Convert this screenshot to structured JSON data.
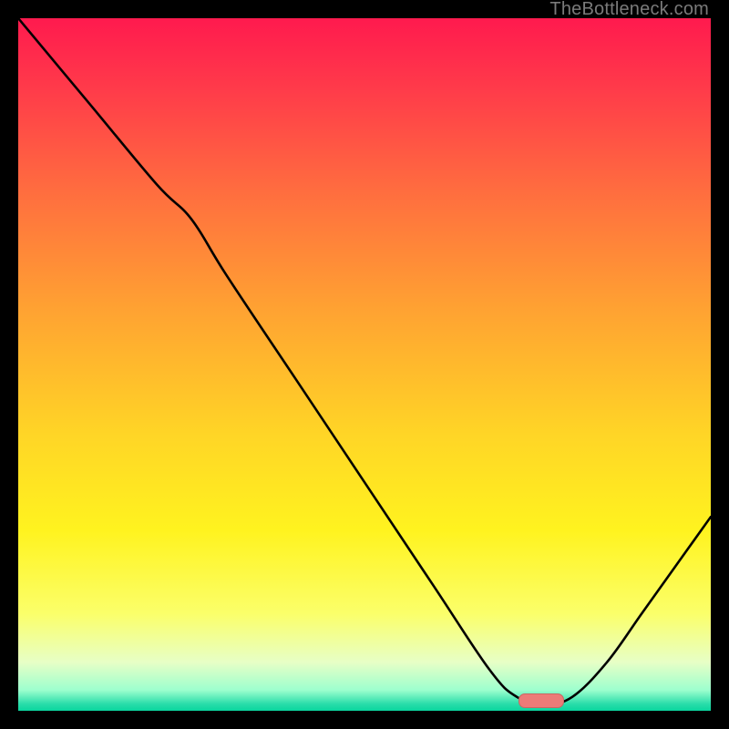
{
  "watermark": "TheBottleneck.com",
  "marker": {
    "u": 0.755,
    "v": 0.986
  },
  "chart_data": {
    "type": "line",
    "title": "",
    "xlabel": "",
    "ylabel": "",
    "xlim": [
      0,
      1
    ],
    "ylim": [
      0,
      1
    ],
    "x": [
      0.0,
      0.1,
      0.2,
      0.25,
      0.3,
      0.4,
      0.5,
      0.6,
      0.68,
      0.72,
      0.76,
      0.8,
      0.85,
      0.9,
      0.95,
      1.0
    ],
    "values": [
      1.0,
      0.88,
      0.76,
      0.71,
      0.63,
      0.48,
      0.33,
      0.18,
      0.06,
      0.02,
      0.01,
      0.02,
      0.07,
      0.14,
      0.21,
      0.28
    ],
    "annotations": [],
    "series": [
      {
        "name": "bottleneck-curve",
        "color": "#000000"
      }
    ],
    "gradient_direction": "vertical",
    "gradient_stops": [
      {
        "pos": 0.0,
        "color": "#ff1a4e"
      },
      {
        "pos": 0.6,
        "color": "#ffd526"
      },
      {
        "pos": 0.86,
        "color": "#fbff6a"
      },
      {
        "pos": 1.0,
        "color": "#0ad69e"
      }
    ]
  }
}
